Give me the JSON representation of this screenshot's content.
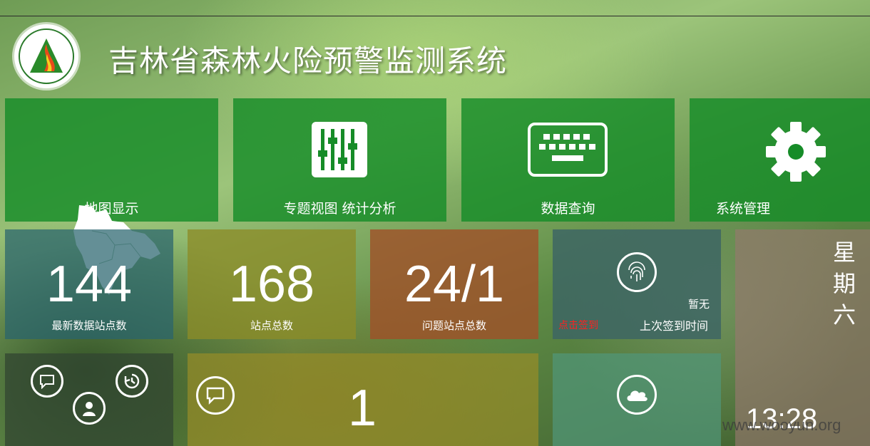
{
  "header": {
    "title": "吉林省森林火险预警监测系统"
  },
  "nav": [
    {
      "label": "地图显示",
      "icon": "jilin-map-icon"
    },
    {
      "label": "专题视图  统计分析",
      "icon": "sliders-icon"
    },
    {
      "label": "数据查询",
      "icon": "keyboard-icon"
    },
    {
      "label": "系统管理",
      "icon": "gear-icon"
    }
  ],
  "stats": [
    {
      "value": "144",
      "caption": "最新数据站点数"
    },
    {
      "value": "168",
      "caption": "站点总数"
    },
    {
      "value": "24/1",
      "caption": "问题站点总数"
    }
  ],
  "checkin": {
    "status": "暂无",
    "action": "点击签到",
    "caption": "上次签到时间",
    "action_color": "#ff2020"
  },
  "messages": {
    "count": "1"
  },
  "datetime": {
    "weekday": [
      "星",
      "期",
      "六"
    ],
    "time": "13:28"
  },
  "watermark": "www.wooyun.org",
  "colors": {
    "nav_tile": "#168c28",
    "stat1": "#3c6e6e",
    "stat2": "#8c8c28",
    "stat3": "#9c5a32",
    "checkin": "#466e6e",
    "cloud": "#5a9a82"
  }
}
